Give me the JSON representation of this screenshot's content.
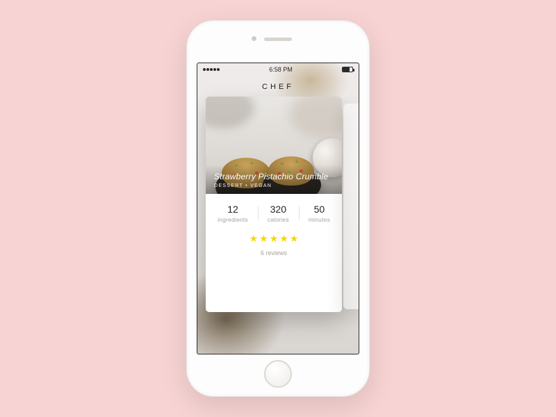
{
  "status_bar": {
    "time": "6:58 PM"
  },
  "app": {
    "title": "CHEF"
  },
  "recipe": {
    "title": "Strawberry Pistachio Crumble",
    "tags": "DESSERT • VEGAN",
    "stats": {
      "ingredients": {
        "value": "12",
        "label": "ingredients"
      },
      "calories": {
        "value": "320",
        "label": "calories"
      },
      "minutes": {
        "value": "50",
        "label": "minutes"
      }
    },
    "rating": {
      "stars": 5,
      "reviews_label": "6 reviews"
    }
  }
}
